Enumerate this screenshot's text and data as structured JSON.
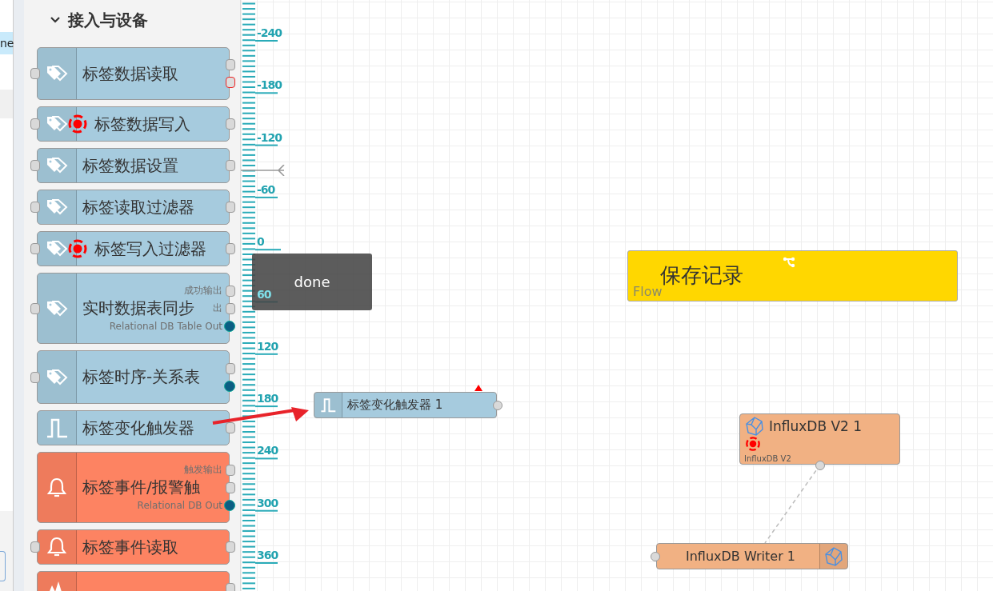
{
  "side_panel": {
    "row_text": "ne"
  },
  "palette": {
    "category": {
      "label": "接入与设备",
      "expanded": true
    },
    "nodes": [
      {
        "label": "标签数据读取",
        "color": "#a6cbde",
        "kind": "tag",
        "debug": false,
        "input": true,
        "outputs": [
          {
            "kind": "normal"
          },
          {
            "kind": "error"
          }
        ]
      },
      {
        "label": "标签数据写入",
        "color": "#a6cbde",
        "kind": "tag",
        "debug": true,
        "input": true,
        "outputs": [
          {
            "kind": "normal"
          }
        ]
      },
      {
        "label": "标签数据设置",
        "color": "#a6cbde",
        "kind": "tag",
        "debug": false,
        "input": true,
        "outputs": [
          {
            "kind": "normal"
          }
        ]
      },
      {
        "label": "标签读取过滤器",
        "color": "#a6cbde",
        "kind": "tag",
        "debug": false,
        "input": true,
        "outputs": [
          {
            "kind": "normal"
          }
        ]
      },
      {
        "label": "标签写入过滤器",
        "color": "#a6cbde",
        "kind": "tag",
        "debug": true,
        "input": true,
        "outputs": [
          {
            "kind": "normal"
          }
        ]
      },
      {
        "label": "实时数据表同步",
        "color": "#a6cbde",
        "kind": "tag",
        "debug": false,
        "input": true,
        "outputs": [
          {
            "kind": "normal",
            "label": "成功输出"
          },
          {
            "kind": "normal",
            "label": "出"
          },
          {
            "kind": "db",
            "label": "Relational DB Table Out"
          }
        ]
      },
      {
        "label": "标签时序-关系表",
        "color": "#a6cbde",
        "kind": "tag",
        "debug": false,
        "input": true,
        "outputs": [
          {
            "kind": "normal"
          },
          {
            "kind": "db"
          }
        ]
      },
      {
        "label": "标签变化触发器",
        "color": "#a6cbde",
        "kind": "pulse",
        "debug": false,
        "input": false,
        "outputs": [
          {
            "kind": "normal"
          }
        ]
      },
      {
        "label": "标签事件/报警触",
        "color": "#fd8362",
        "kind": "bell",
        "debug": false,
        "input": false,
        "outputs": [
          {
            "kind": "normal",
            "label": "触发输出"
          },
          {
            "kind": "normal"
          },
          {
            "kind": "db",
            "label": "Relational DB Out"
          }
        ]
      },
      {
        "label": "标签事件读取",
        "color": "#fd8362",
        "kind": "bell",
        "debug": false,
        "input": true,
        "outputs": [
          {
            "kind": "normal"
          }
        ]
      },
      {
        "color": "#fd8362",
        "kind": "peaks",
        "debug": false,
        "input": false,
        "outputs": [
          {
            "kind": "normal"
          }
        ]
      }
    ]
  },
  "ruler": {
    "labels": [
      "-240",
      "-180",
      "-120",
      "-60",
      "0",
      "60",
      "120",
      "180",
      "240",
      "300",
      "360"
    ]
  },
  "tooltip": {
    "text": "done"
  },
  "canvas": {
    "group": {
      "title": "保存记录",
      "type_label": "Flow"
    },
    "nodes": [
      {
        "kind": "trigger",
        "label": "标签变化触发器 1",
        "changed": true
      },
      {
        "kind": "influx",
        "label": "InfluxDB V2 1",
        "sublabel": "InfluxDB V2",
        "debug": true
      },
      {
        "kind": "writer",
        "label": "InfluxDB Writer 1"
      }
    ]
  }
}
